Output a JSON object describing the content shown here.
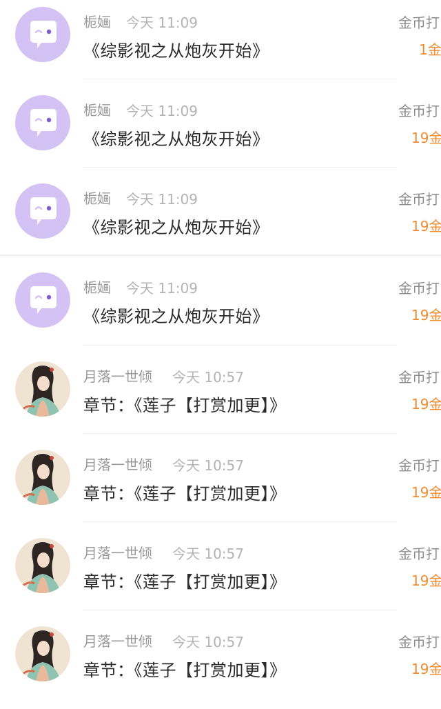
{
  "items": [
    {
      "avatar": "bubble-avatar-icon",
      "name": "栀婳",
      "time": "今天 11:09",
      "title": "《综影视之从炮灰开始》",
      "reward_label": "金币打",
      "amount": "1金"
    },
    {
      "avatar": "bubble-avatar-icon",
      "name": "栀婳",
      "time": "今天 11:09",
      "title": "《综影视之从炮灰开始》",
      "reward_label": "金币打",
      "amount": "19金"
    },
    {
      "avatar": "bubble-avatar-icon",
      "name": "栀婳",
      "time": "今天 11:09",
      "title": "《综影视之从炮灰开始》",
      "reward_label": "金币打",
      "amount": "19金"
    },
    {
      "avatar": "bubble-avatar-icon",
      "name": "栀婳",
      "time": "今天 11:09",
      "title": "《综影视之从炮灰开始》",
      "reward_label": "金币打",
      "amount": "19金"
    },
    {
      "avatar": "portrait-avatar",
      "name": "月落一世倾",
      "time": "今天 10:57",
      "title": "章节：《莲子【打赏加更】》",
      "reward_label": "金币打",
      "amount": "19金"
    },
    {
      "avatar": "portrait-avatar",
      "name": "月落一世倾",
      "time": "今天 10:57",
      "title": "章节：《莲子【打赏加更】》",
      "reward_label": "金币打",
      "amount": "19金"
    },
    {
      "avatar": "portrait-avatar",
      "name": "月落一世倾",
      "time": "今天 10:57",
      "title": "章节：《莲子【打赏加更】》",
      "reward_label": "金币打",
      "amount": "19金"
    },
    {
      "avatar": "portrait-avatar",
      "name": "月落一世倾",
      "time": "今天 10:57",
      "title": "章节：《莲子【打赏加更】》",
      "reward_label": "金币打",
      "amount": "19金"
    }
  ],
  "colors": {
    "accent_amount": "#f08a2e",
    "bubble_avatar_bg": "#d4c2f5",
    "name_gray": "#9a9a9a"
  }
}
